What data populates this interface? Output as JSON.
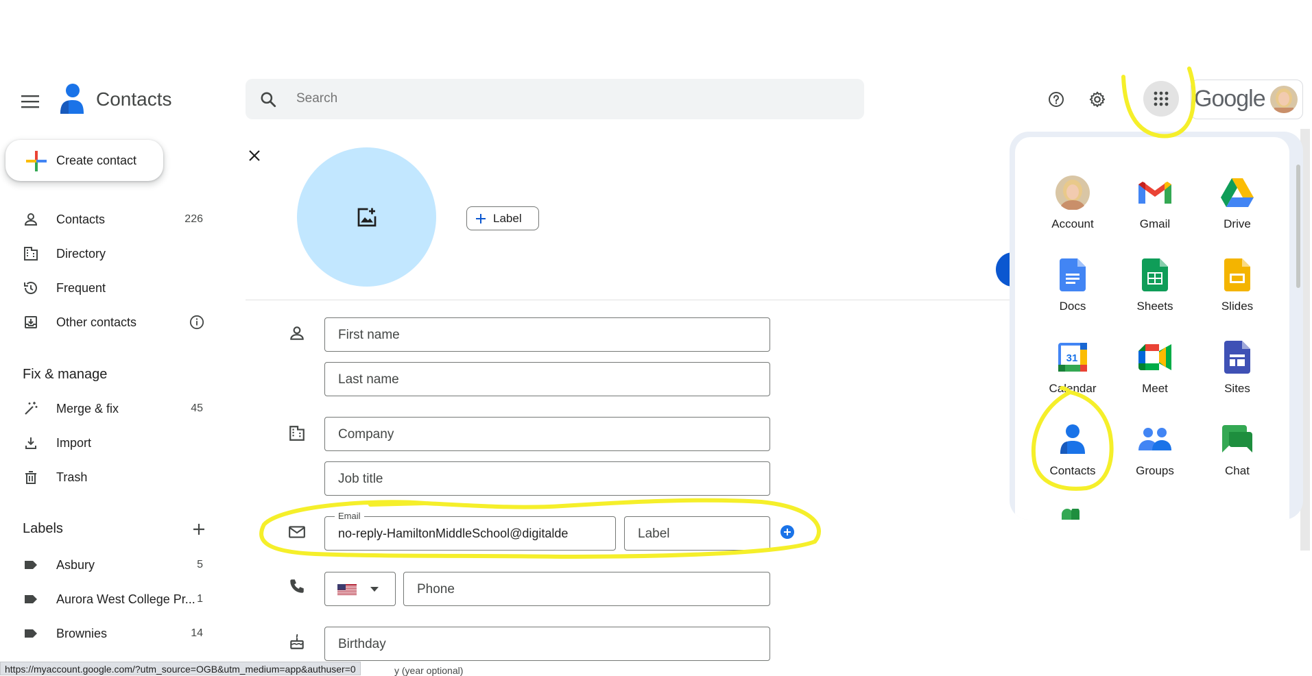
{
  "header": {
    "app_title": "Contacts",
    "search_placeholder": "Search",
    "brand": "Google",
    "icons": [
      "menu-icon",
      "contacts-logo-icon",
      "search-icon",
      "help-icon",
      "settings-icon",
      "apps-grid-icon",
      "avatar"
    ]
  },
  "sidebar": {
    "create_label": "Create contact",
    "items": [
      {
        "label": "Contacts",
        "count": "226",
        "icon": "person-icon"
      },
      {
        "label": "Directory",
        "count": "",
        "icon": "building-icon"
      },
      {
        "label": "Frequent",
        "count": "",
        "icon": "history-icon"
      },
      {
        "label": "Other contacts",
        "count": "",
        "icon": "download-box-icon"
      }
    ],
    "fix_heading": "Fix & manage",
    "fix_items": [
      {
        "label": "Merge & fix",
        "count": "45"
      },
      {
        "label": "Import",
        "count": ""
      },
      {
        "label": "Trash",
        "count": ""
      }
    ],
    "labels_heading": "Labels",
    "labels": [
      {
        "label": "Asbury",
        "count": "5"
      },
      {
        "label": "Aurora West College Pr...",
        "count": "1"
      },
      {
        "label": "Brownies",
        "count": "14"
      }
    ]
  },
  "form": {
    "label_button": "Label",
    "first_name_placeholder": "First name",
    "last_name_placeholder": "Last name",
    "company_placeholder": "Company",
    "job_title_placeholder": "Job title",
    "email_label": "Email",
    "email_value": "no-reply-HamiltonMiddleSchool@digitalde",
    "email_label_placeholder": "Label",
    "phone_placeholder": "Phone",
    "birthday_placeholder": "Birthday",
    "birthday_hint": "y (year optional)"
  },
  "apps_panel": {
    "apps": [
      {
        "name": "Account",
        "icon": "account-avatar-icon"
      },
      {
        "name": "Gmail",
        "icon": "gmail-icon"
      },
      {
        "name": "Drive",
        "icon": "drive-icon"
      },
      {
        "name": "Docs",
        "icon": "docs-icon"
      },
      {
        "name": "Sheets",
        "icon": "sheets-icon"
      },
      {
        "name": "Slides",
        "icon": "slides-icon"
      },
      {
        "name": "Calendar",
        "icon": "calendar-icon",
        "badge": "31"
      },
      {
        "name": "Meet",
        "icon": "meet-icon"
      },
      {
        "name": "Sites",
        "icon": "sites-icon"
      },
      {
        "name": "Contacts",
        "icon": "contacts-icon"
      },
      {
        "name": "Groups",
        "icon": "groups-icon"
      },
      {
        "name": "Chat",
        "icon": "chat-icon"
      }
    ]
  },
  "status_bar": {
    "url": "https://myaccount.google.com/?utm_source=OGB&utm_medium=app&authuser=0"
  },
  "colors": {
    "highlight": "#f5ef2a",
    "accent": "#1a73e8",
    "photo_bg": "#c2e7ff"
  }
}
